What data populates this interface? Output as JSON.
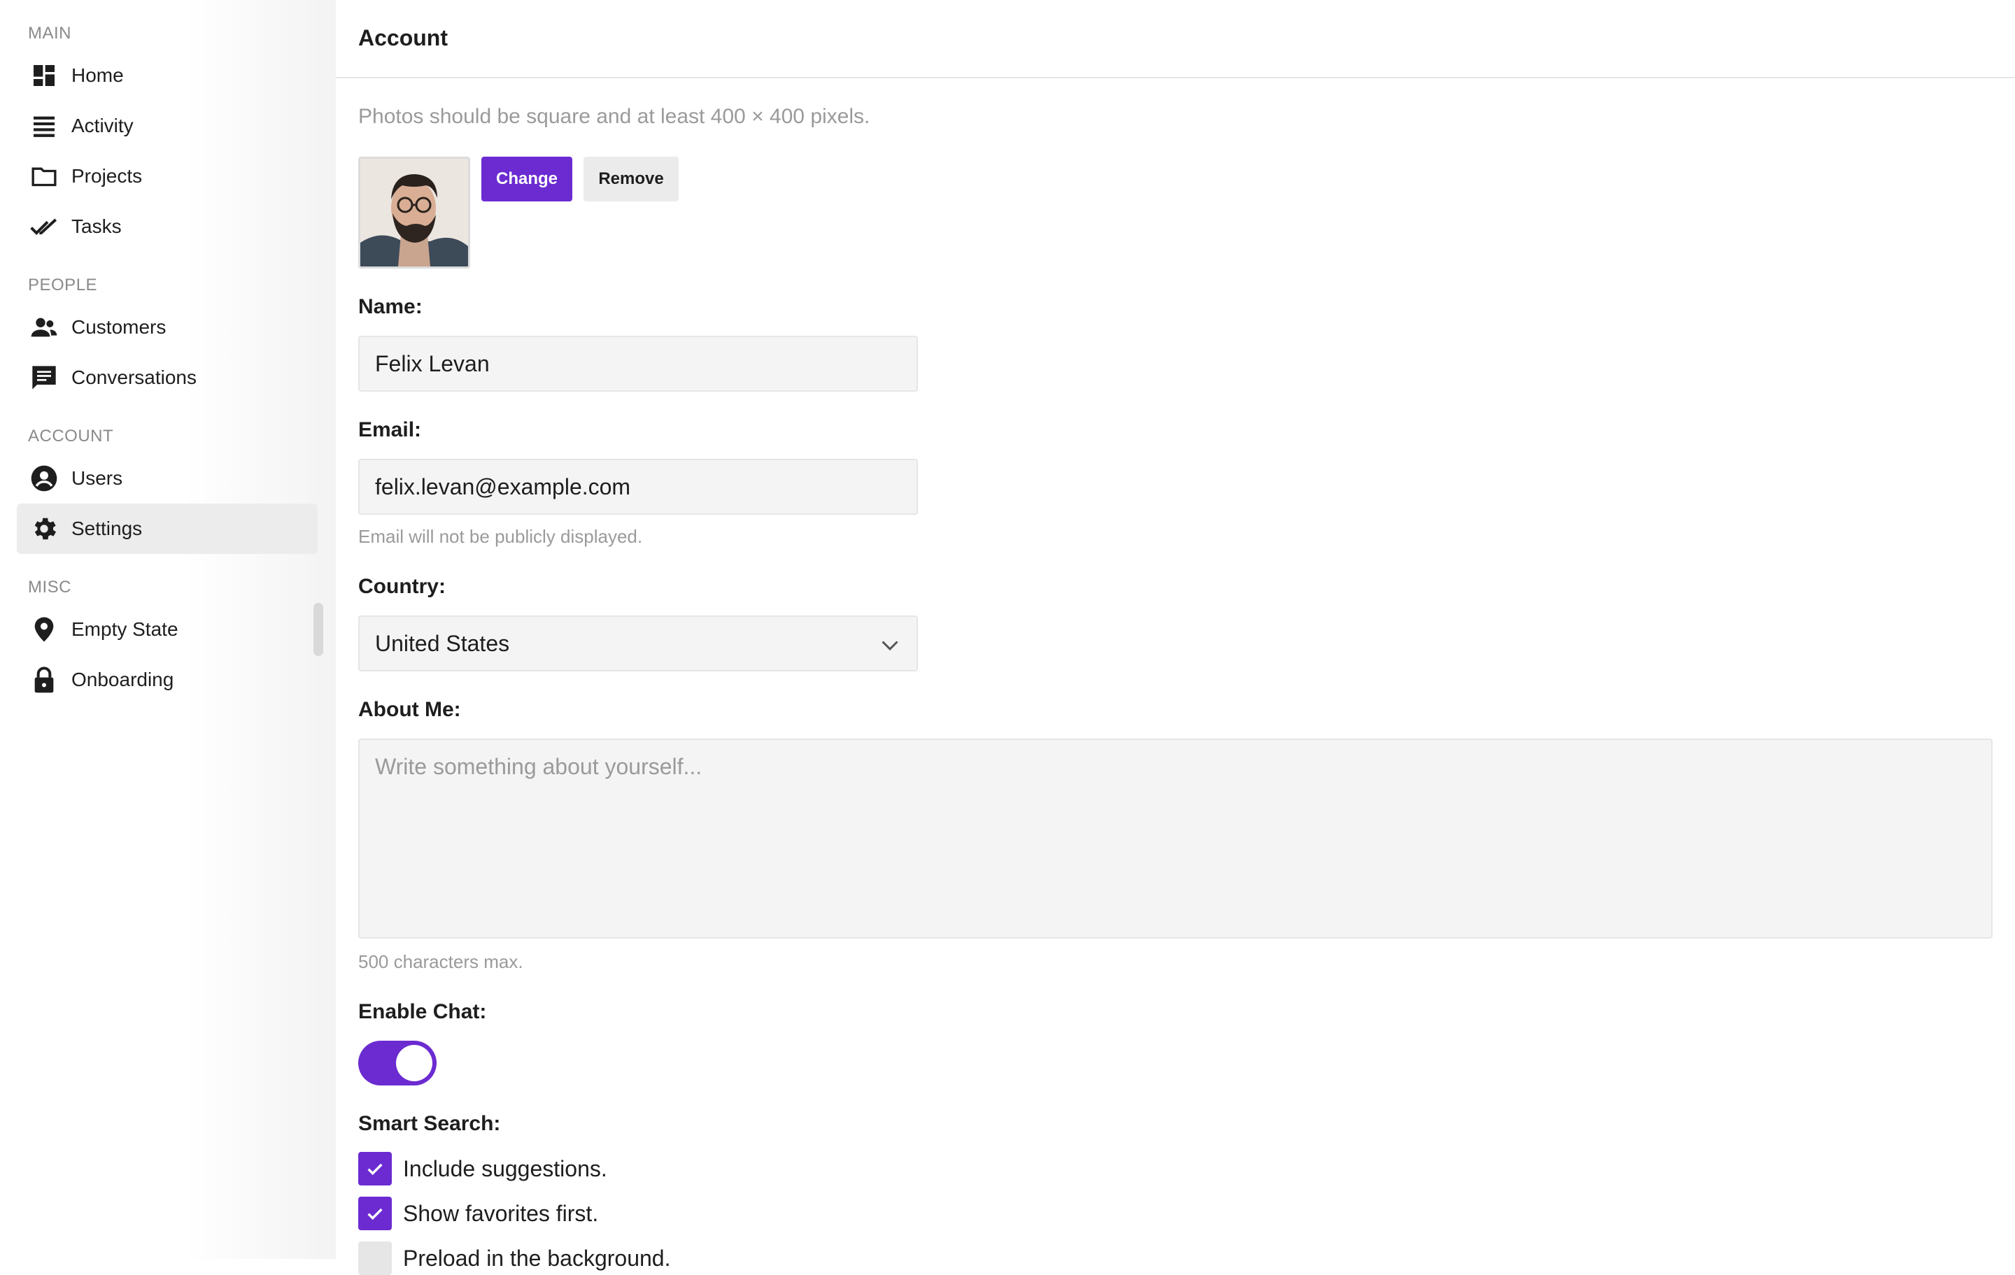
{
  "sidebar": {
    "sections": [
      {
        "title": "MAIN",
        "items": [
          {
            "label": "Home",
            "icon": "dashboard-icon"
          },
          {
            "label": "Activity",
            "icon": "list-icon"
          },
          {
            "label": "Projects",
            "icon": "folder-icon"
          },
          {
            "label": "Tasks",
            "icon": "double-check-icon"
          }
        ]
      },
      {
        "title": "PEOPLE",
        "items": [
          {
            "label": "Customers",
            "icon": "people-icon"
          },
          {
            "label": "Conversations",
            "icon": "chat-icon"
          }
        ]
      },
      {
        "title": "ACCOUNT",
        "items": [
          {
            "label": "Users",
            "icon": "user-circle-icon"
          },
          {
            "label": "Settings",
            "icon": "gear-icon",
            "active": true
          }
        ]
      },
      {
        "title": "MISC",
        "items": [
          {
            "label": "Empty State",
            "icon": "map-pin-icon"
          },
          {
            "label": "Onboarding",
            "icon": "lock-icon"
          }
        ]
      }
    ]
  },
  "header": {
    "title": "Account"
  },
  "photo": {
    "hint": "Photos should be square and at least 400 × 400 pixels.",
    "change_label": "Change",
    "remove_label": "Remove"
  },
  "form": {
    "name_label": "Name:",
    "name_value": "Felix Levan",
    "email_label": "Email:",
    "email_value": "felix.levan@example.com",
    "email_hint": "Email will not be publicly displayed.",
    "country_label": "Country:",
    "country_value": "United States",
    "about_label": "About Me:",
    "about_placeholder": "Write something about yourself...",
    "about_hint": "500 characters max.",
    "chat_label": "Enable Chat:",
    "chat_enabled": true,
    "search_label": "Smart Search:",
    "search_options": [
      {
        "label": "Include suggestions.",
        "checked": true
      },
      {
        "label": "Show favorites first.",
        "checked": true
      },
      {
        "label": "Preload in the background.",
        "checked": false
      }
    ]
  },
  "colors": {
    "accent": "#6b2bd1",
    "field_bg": "#f4f4f5"
  }
}
